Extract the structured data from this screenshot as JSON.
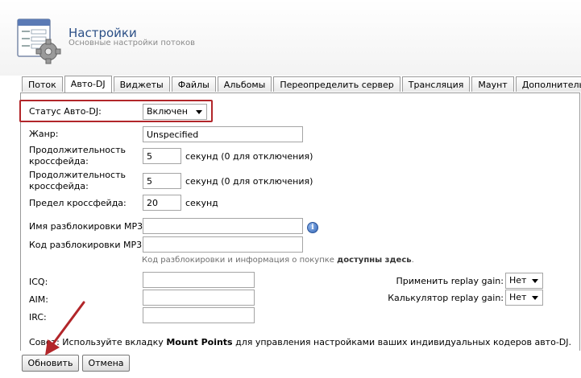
{
  "header": {
    "title": "Настройки",
    "subtitle": "Основные настройки потоков"
  },
  "tabs": [
    {
      "label": "Поток",
      "active": false
    },
    {
      "label": "Авто-DJ",
      "active": true
    },
    {
      "label": "Виджеты",
      "active": false
    },
    {
      "label": "Файлы",
      "active": false
    },
    {
      "label": "Альбомы",
      "active": false
    },
    {
      "label": "Переопределить сервер",
      "active": false
    },
    {
      "label": "Трансляция",
      "active": false
    },
    {
      "label": "Маунт",
      "active": false
    },
    {
      "label": "Дополнительно",
      "active": false
    }
  ],
  "form": {
    "autodj_status": {
      "label": "Статус Авто-DJ:",
      "value": "Включен"
    },
    "genre": {
      "label": "Жанр:",
      "value": "Unspecified"
    },
    "crossfade1": {
      "label_line1": "Продолжительность",
      "label_line2": "кроссфейда:",
      "value": "5",
      "unit": "секунд (0 для отключения)"
    },
    "crossfade2": {
      "label_line1": "Продолжительность",
      "label_line2": "кроссфейда:",
      "value": "5",
      "unit": "секунд (0 для отключения)"
    },
    "crossfade_limit": {
      "label": "Предел кроссфейда:",
      "value": "20",
      "unit": "секунд"
    },
    "mp3_unlock_name": {
      "label": "Имя разблокировки MP3:",
      "value": ""
    },
    "mp3_unlock_code": {
      "label": "Код разблокировки MP3:",
      "value": ""
    },
    "unlock_note": {
      "text": "Код разблокировки и информация о покупке ",
      "bold": "доступны здесь",
      "end": "."
    },
    "icq": {
      "label": "ICQ:",
      "value": ""
    },
    "aim": {
      "label": "AIM:",
      "value": ""
    },
    "irc": {
      "label": "IRC:",
      "value": ""
    },
    "apply_replay_gain": {
      "label": "Применить replay gain:",
      "value": "Нет"
    },
    "replay_gain_calc": {
      "label": "Калькулятор replay gain:",
      "value": "Нет"
    }
  },
  "tip": {
    "prefix": "Совет: Используйте вкладку ",
    "bold": "Mount Points",
    "suffix": " для управления настройками ваших индивидуальных кодеров авто-DJ."
  },
  "buttons": {
    "update": "Обновить",
    "cancel": "Отмена"
  },
  "colors": {
    "title": "#2b4f86",
    "highlight": "#b2262a",
    "arrow": "#b2262a"
  }
}
